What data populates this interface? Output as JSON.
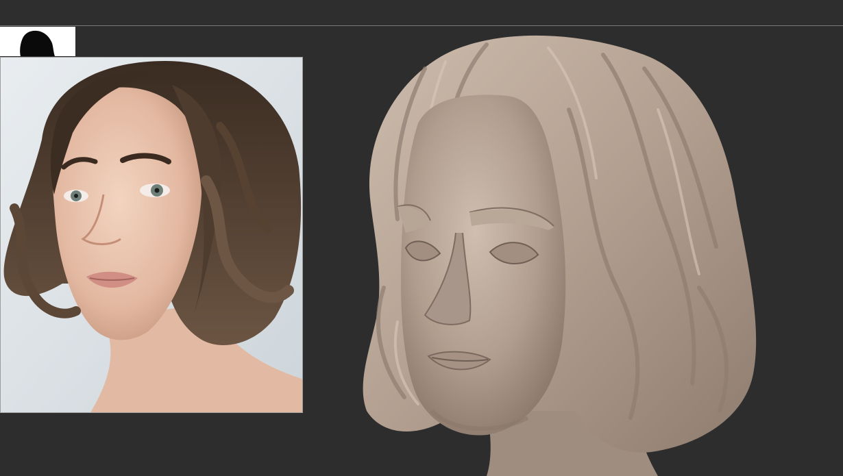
{
  "viewport": {
    "background": "#2d2d2d",
    "divider_color": "#7a7a7a"
  },
  "reference_thumbnail": {
    "icon": "head-silhouette-icon",
    "background": "#ffffff",
    "silhouette_color": "#0a0a0a"
  },
  "reference_photo": {
    "subject": "woman-portrait-bob-haircut",
    "background": "#dfe4e8",
    "hair_color": "#4a3a2e",
    "skin_color": "#e8c2ac"
  },
  "sculpt_model": {
    "subject": "female-head-bust-clay",
    "clay_color": "#b5a293",
    "clay_shadow": "#8d7b6e",
    "clay_highlight": "#d4c4b6"
  }
}
